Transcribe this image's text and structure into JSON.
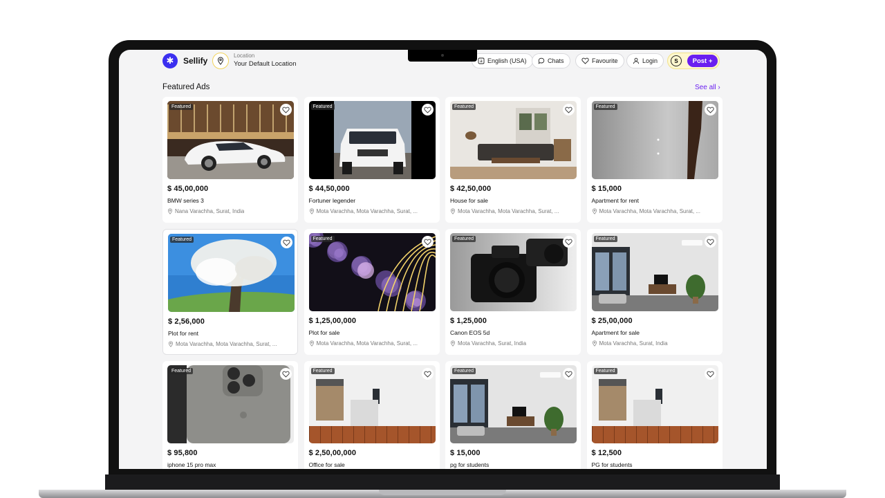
{
  "brand": {
    "name": "Sellify"
  },
  "location": {
    "label": "Location",
    "value": "Your Default Location"
  },
  "header": {
    "language": "English (USA)",
    "chats": "Chats",
    "favourite": "Favourite",
    "login": "Login",
    "post": "Post +"
  },
  "section": {
    "title": "Featured Ads",
    "see_all": "See all ›"
  },
  "badge_text": "Featured",
  "listings": [
    {
      "price": "$ 45,00,000",
      "title": "BMW series 3",
      "location": "Nana Varachha, Surat, India",
      "image": "car-showroom"
    },
    {
      "price": "$ 44,50,000",
      "title": "Fortuner legender",
      "location": "Mota Varachha, Mota Varachha, Surat, ...",
      "image": "white-suv"
    },
    {
      "price": "$ 42,50,000",
      "title": "House for sale",
      "location": "Mota Varachha, Mota Varachha, Surat, ...",
      "image": "living-room"
    },
    {
      "price": "$ 15,000",
      "title": "Apartment for rent",
      "location": "Mota Varachha, Mota Varachha, Surat, ...",
      "image": "empty-room"
    },
    {
      "price": "$ 2,56,000",
      "title": "Plot for rent",
      "location": "Mota Varachha, Mota Varachha, Surat, ...",
      "image": "blossom-tree"
    },
    {
      "price": "$ 1,25,00,000",
      "title": "Plot for sale",
      "location": "Mota Varachha, Mota Varachha, Surat, ...",
      "image": "abstract-flowers"
    },
    {
      "price": "$ 1,25,000",
      "title": "Canon EOS 5d",
      "location": "Mota Varachha, Surat, India",
      "image": "camera"
    },
    {
      "price": "$ 25,00,000",
      "title": "Apartment for sale",
      "location": "Mota Varachha, Surat, India",
      "image": "apartment"
    },
    {
      "price": "$ 95,800",
      "title": "iphone 15 pro max",
      "location": "",
      "image": "phone"
    },
    {
      "price": "$ 2,50,00,000",
      "title": "Office for sale",
      "location": "",
      "image": "office"
    },
    {
      "price": "$ 15,000",
      "title": "pg for students",
      "location": "",
      "image": "apartment"
    },
    {
      "price": "$ 12,500",
      "title": "PG for students",
      "location": "",
      "image": "office"
    }
  ]
}
